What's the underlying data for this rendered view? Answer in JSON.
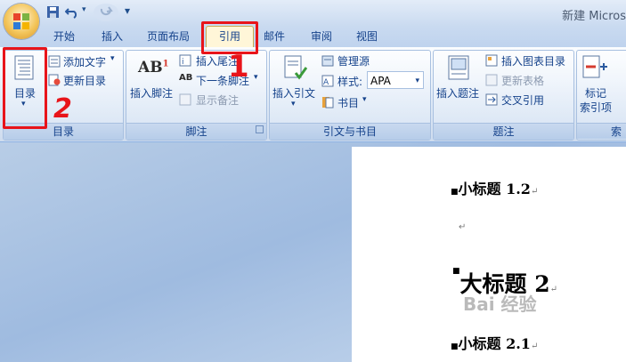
{
  "window": {
    "title": "新建 Micros"
  },
  "tabs": [
    "开始",
    "插入",
    "页面布局",
    "引用",
    "邮件",
    "审阅",
    "视图"
  ],
  "ribbon": {
    "toc_group": {
      "label": "目录",
      "toc_button": "目录",
      "add_text": "添加文字",
      "update_toc": "更新目录"
    },
    "footnote_group": {
      "label": "脚注",
      "insert_footnote": "插入脚注",
      "insert_endnote": "插入尾注",
      "next_footnote": "下一条脚注",
      "show_notes": "显示备注",
      "ab_glyph": "AB",
      "ab_sup": "1"
    },
    "citation_group": {
      "label": "引文与书目",
      "insert_citation": "插入引文",
      "manage_sources": "管理源",
      "style_label": "样式:",
      "style_value": "APA",
      "bibliography": "书目"
    },
    "caption_group": {
      "label": "题注",
      "insert_caption": "插入题注",
      "insert_table_of_figures": "插入图表目录",
      "update_table": "更新表格",
      "cross_reference": "交叉引用"
    },
    "index_group": {
      "mark_entry_line1": "标记",
      "mark_entry_line2": "索引项",
      "partial_label": "索"
    }
  },
  "document": {
    "heading_1": "小标题 1.2",
    "heading_2": "大标题 2",
    "heading_3": "小标题 2.1"
  },
  "annotations": {
    "one": "1",
    "two": "2"
  },
  "watermark": "Bai 经验"
}
